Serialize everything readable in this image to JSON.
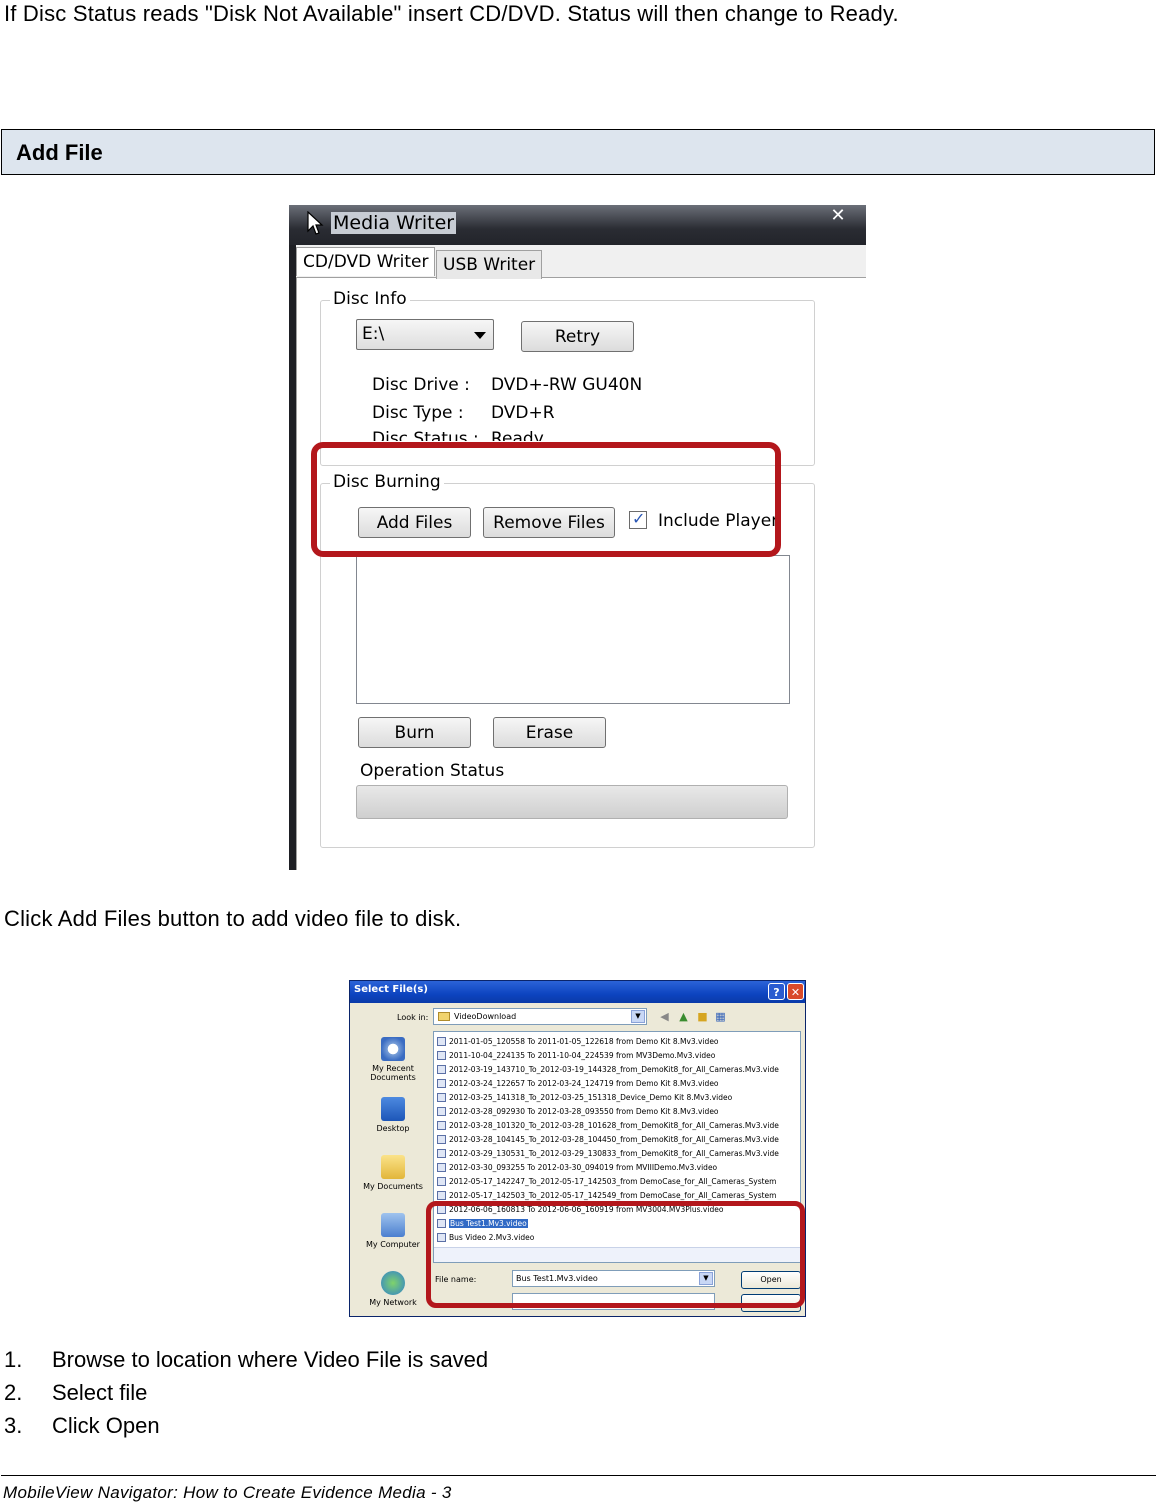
{
  "intro_text": "If Disc Status reads \"Disk Not Available\" insert CD/DVD.  Status will then change to Ready.",
  "section_title": "Add File",
  "media_writer": {
    "window_title": "Media Writer",
    "close_glyph": "✕",
    "tabs": [
      "CD/DVD Writer",
      "USB Writer"
    ],
    "disc_info_label": "Disc Info",
    "drive_value": "E:\\",
    "retry_label": "Retry",
    "disc_drive_label": "Disc Drive :",
    "disc_drive_value": "DVD+-RW GU40N",
    "disc_type_label": "Disc Type :",
    "disc_type_value": "DVD+R",
    "disc_status_label": "Disc Status :",
    "disc_status_value": "Ready",
    "disc_burning_label": "Disc Burning",
    "add_files_label": "Add Files",
    "remove_files_label": "Remove Files",
    "include_player_label": "Include Player",
    "include_player_checked": true,
    "burn_label": "Burn",
    "erase_label": "Erase",
    "operation_status_label": "Operation Status",
    "highlight_color": "#b3171c"
  },
  "caption_add_files": "Click Add Files button to add video file to disk.",
  "select_dialog": {
    "title": "Select File(s)",
    "look_in_label": "Look in:",
    "look_in_value": "VideoDownload",
    "places": [
      "My Recent Documents",
      "Desktop",
      "My Documents",
      "My Computer",
      "My Network"
    ],
    "files": [
      "2011-01-05_120558 To 2011-01-05_122618 from Demo Kit 8.Mv3.video",
      "2011-10-04_224135 To 2011-10-04_224539 from MV3Demo.Mv3.video",
      "2012-03-19_143710_To_2012-03-19_144328_from_DemoKit8_for_All_Cameras.Mv3.vide",
      "2012-03-24_122657 To 2012-03-24_124719 from Demo Kit 8.Mv3.video",
      "2012-03-25_141318_To_2012-03-25_151318_Device_Demo Kit 8.Mv3.video",
      "2012-03-28_092930 To 2012-03-28_093550 from Demo Kit 8.Mv3.video",
      "2012-03-28_101320_To_2012-03-28_101628_from_DemoKit8_for_All_Cameras.Mv3.vide",
      "2012-03-28_104145_To_2012-03-28_104450_from_DemoKit8_for_All_Cameras.Mv3.vide",
      "2012-03-29_130531_To_2012-03-29_130833_from_DemoKit8_for_All_Cameras.Mv3.vide",
      "2012-03-30_093255 To 2012-03-30_094019 from MVIIIDemo.Mv3.video",
      "2012-05-17_142247_To_2012-05-17_142503_from DemoCase_for_All_Cameras_System",
      "2012-05-17_142503_To_2012-05-17_142549_from DemoCase_for_All_Cameras_System",
      "2012-06-06_160813 To 2012-06-06_160919 from MV3004.MV3Plus.video",
      "Bus Test1.Mv3.video",
      "Bus Video 2.Mv3.video"
    ],
    "selected_file": "Bus Test1.Mv3.video",
    "file_name_label": "File name:",
    "file_name_value": "Bus Test1.Mv3.video",
    "open_label": "Open",
    "help_glyph": "?",
    "close_glyph": "✕"
  },
  "steps": [
    {
      "num": "1.",
      "text": "Browse to location where Video File is saved"
    },
    {
      "num": "2.",
      "text": "Select file"
    },
    {
      "num": "3.",
      "text": "Click Open"
    }
  ],
  "footer": "MobileView Navigator: How to Create Evidence Media - 3"
}
